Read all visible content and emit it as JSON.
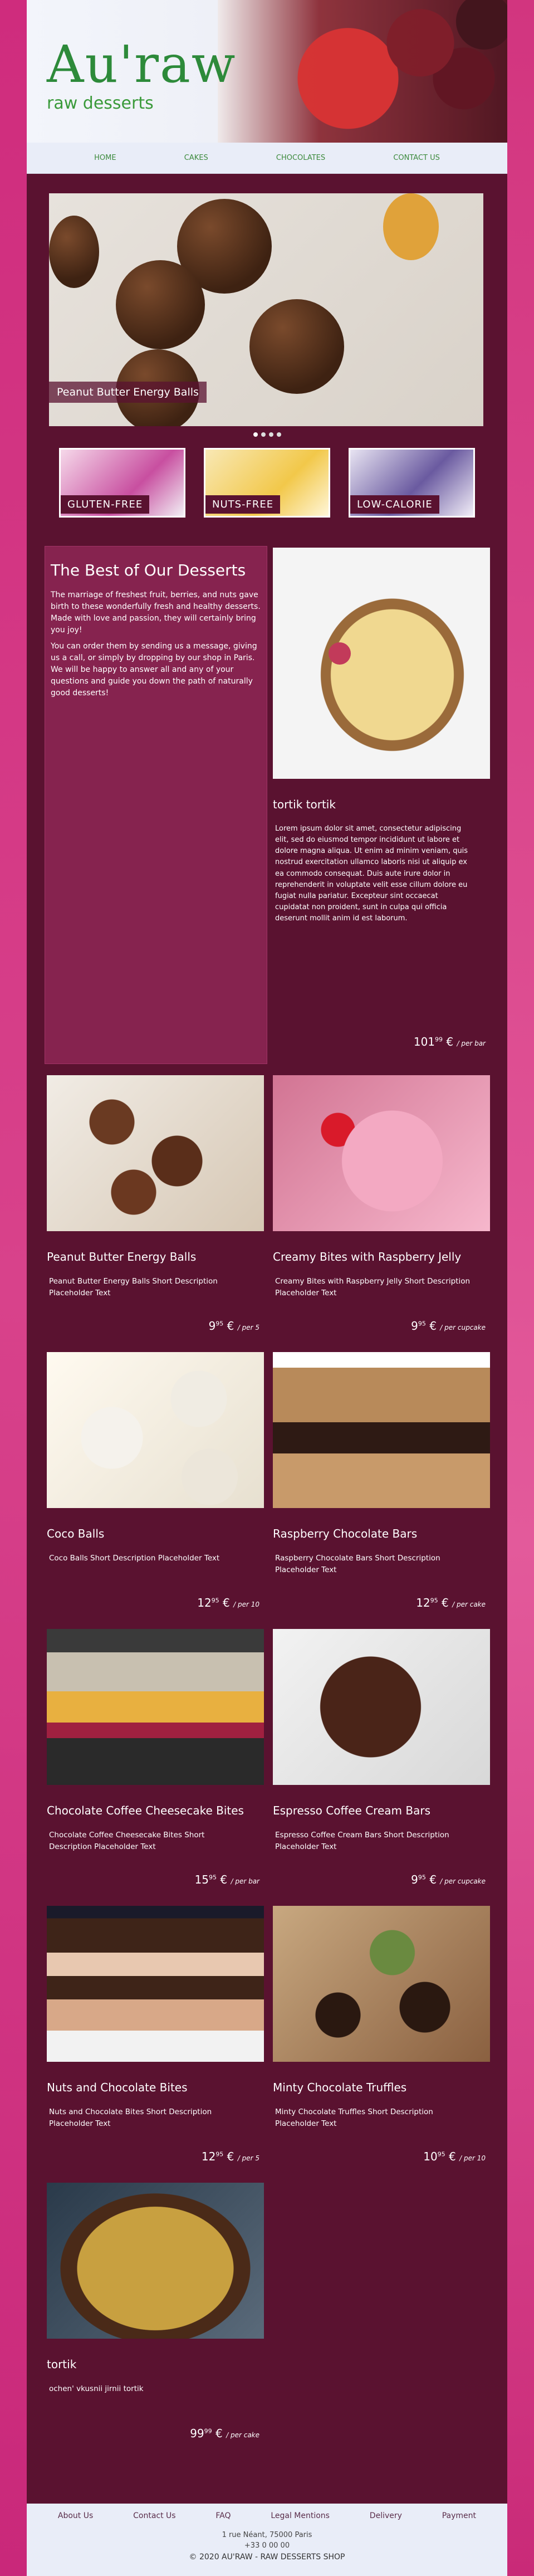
{
  "brand": {
    "logo": "Au'raw",
    "tagline": "raw desserts"
  },
  "nav": [
    "HOME",
    "CAKES",
    "CHOCOLATES",
    "CONTACT US"
  ],
  "slider": {
    "caption": "Peanut Butter Energy Balls",
    "active_slide": 1,
    "slide_count": 4
  },
  "categories": [
    "GLUTEN-FREE",
    "NUTS-FREE",
    "LOW-CALORIE"
  ],
  "intro": {
    "title": "The Best of Our Desserts",
    "p1": "The marriage of freshest fruit, berries, and nuts gave birth to these wonderfully fresh and healthy desserts. Made with love and passion, they will certainly bring you joy!",
    "p2": "You can order them by sending us a message, giving us a call, or simply by dropping by our shop in Paris. We will be happy to answer all and any of your questions and guide you down the path of naturally good desserts!"
  },
  "featured": {
    "title": "tortik tortik",
    "desc": "Lorem ipsum dolor sit amet, consectetur adipiscing elit, sed do eiusmod tempor incididunt ut labore et dolore magna aliqua. Ut enim ad minim veniam, quis nostrud exercitation ullamco laboris nisi ut aliquip ex ea commodo consequat. Duis aute irure dolor in reprehenderit in voluptate velit esse cillum dolore eu fugiat nulla pariatur. Excepteur sint occaecat cupidatat non proident, sunt in culpa qui officia deserunt mollit anim id est laborum.",
    "price_int": "101",
    "price_dec": "99",
    "currency": "€",
    "unit": "/ per bar"
  },
  "products": [
    {
      "title": "Peanut Butter Energy Balls",
      "desc": "Peanut Butter Energy Balls Short Description Placeholder Text",
      "price_int": "9",
      "price_dec": "95",
      "unit": "/ per 5"
    },
    {
      "title": "Creamy Bites with Raspberry Jelly",
      "desc": "Creamy Bites with Raspberry Jelly Short Description Placeholder Text",
      "price_int": "9",
      "price_dec": "95",
      "unit": "/ per cupcake"
    },
    {
      "title": "Coco Balls",
      "desc": "Coco Balls Short Description Placeholder Text",
      "price_int": "12",
      "price_dec": "95",
      "unit": "/ per 10"
    },
    {
      "title": "Raspberry Chocolate Bars",
      "desc": "Raspberry Chocolate Bars Short Description Placeholder Text",
      "price_int": "12",
      "price_dec": "95",
      "unit": "/ per cake"
    },
    {
      "title": "Chocolate Coffee Cheesecake Bites",
      "desc": "Chocolate Coffee Cheesecake Bites Short Description Placeholder Text",
      "price_int": "15",
      "price_dec": "95",
      "unit": "/ per bar"
    },
    {
      "title": "Espresso Coffee Cream Bars",
      "desc": "Espresso Coffee Cream Bars Short Description Placeholder Text",
      "price_int": "9",
      "price_dec": "95",
      "unit": "/ per cupcake"
    },
    {
      "title": "Nuts and Chocolate Bites",
      "desc": "Nuts and Chocolate Bites Short Description Placeholder Text",
      "price_int": "12",
      "price_dec": "95",
      "unit": "/ per 5"
    },
    {
      "title": "Minty Chocolate Truffles",
      "desc": "Minty Chocolate Truffles Short Description Placeholder Text",
      "price_int": "10",
      "price_dec": "95",
      "unit": "/ per 10"
    },
    {
      "title": "tortik",
      "desc": "ochen' vkusnii jirnii tortik",
      "price_int": "99",
      "price_dec": "99",
      "unit": "/ per cake"
    }
  ],
  "footer": {
    "links": [
      "About Us",
      "Contact Us",
      "FAQ",
      "Legal Mentions",
      "Delivery",
      "Payment"
    ],
    "address": "1 rue Néant, 75000 Paris",
    "phone": "+33 0 00 00",
    "copyright": "© 2020 AU'RAW - RAW DESSERTS SHOP"
  }
}
